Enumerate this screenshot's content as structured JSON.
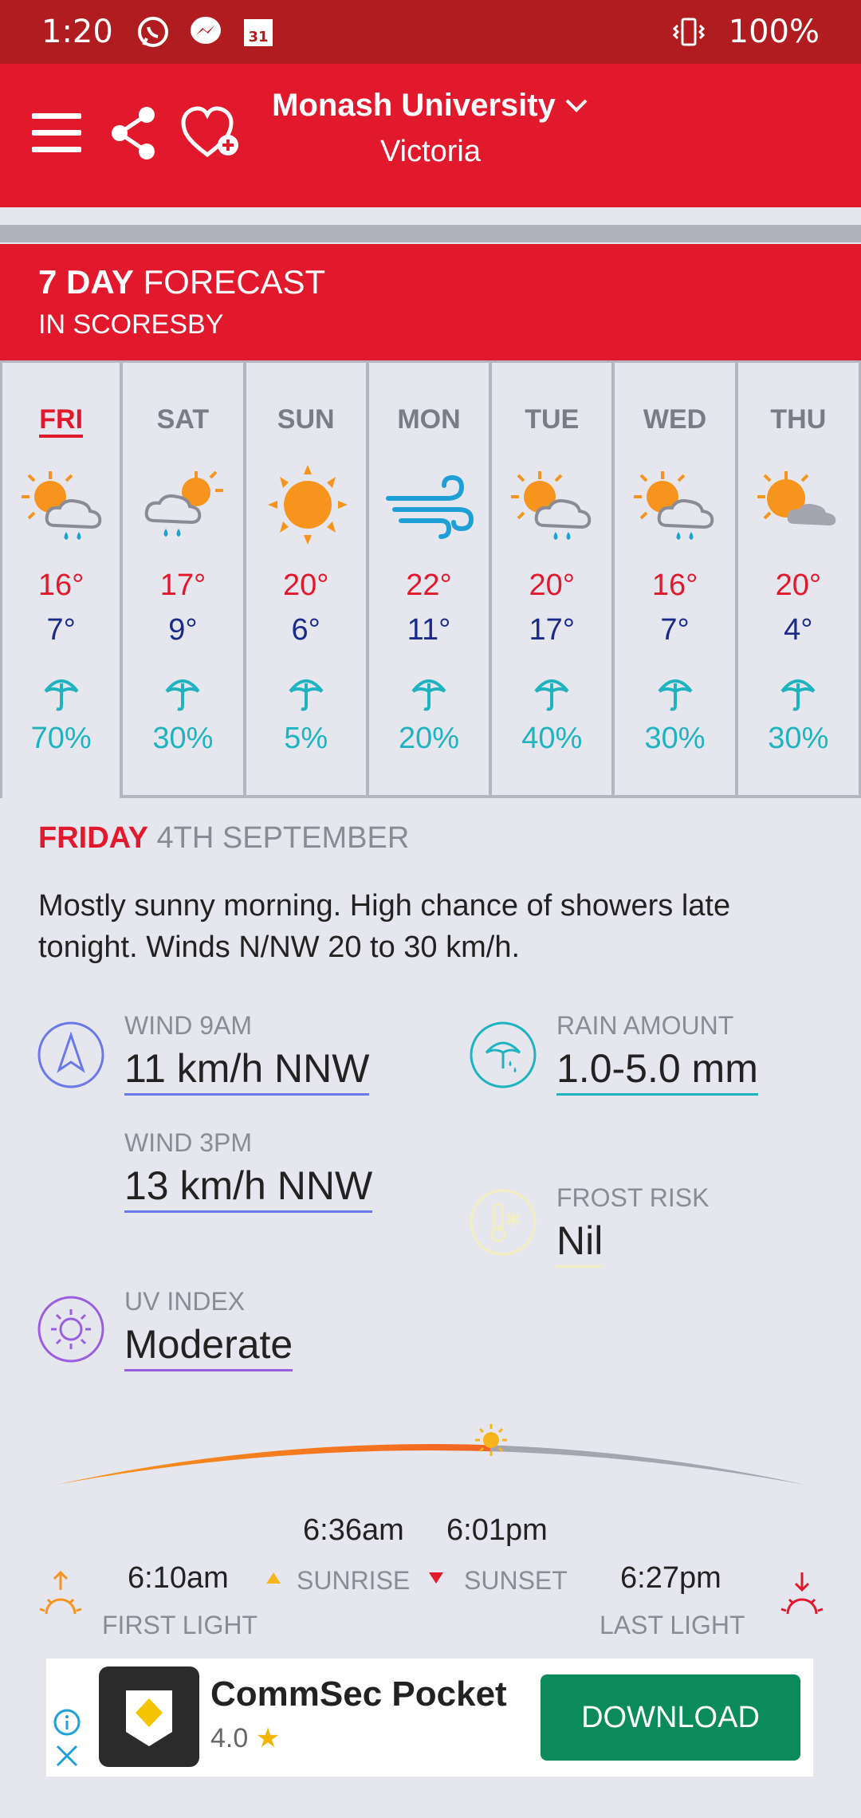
{
  "status_bar": {
    "time": "1:20",
    "battery": "100%"
  },
  "header": {
    "location_name": "Monash University",
    "location_region": "Victoria"
  },
  "forecast_header": {
    "title_bold": "7 DAY",
    "title_rest": "FORECAST",
    "subtitle": "IN SCORESBY"
  },
  "days": [
    {
      "name": "FRI",
      "icon": "sun-cloud-rain-icon",
      "high": "16°",
      "low": "7°",
      "rain_chance": "70%",
      "selected": true
    },
    {
      "name": "SAT",
      "icon": "cloud-sun-rain-icon",
      "high": "17°",
      "low": "9°",
      "rain_chance": "30%"
    },
    {
      "name": "SUN",
      "icon": "sun-icon",
      "high": "20°",
      "low": "6°",
      "rain_chance": "5%"
    },
    {
      "name": "MON",
      "icon": "wind-icon",
      "high": "22°",
      "low": "11°",
      "rain_chance": "20%"
    },
    {
      "name": "TUE",
      "icon": "sun-cloud-rain-icon",
      "high": "20°",
      "low": "17°",
      "rain_chance": "40%"
    },
    {
      "name": "WED",
      "icon": "sun-cloud-rain-icon",
      "high": "16°",
      "low": "7°",
      "rain_chance": "30%"
    },
    {
      "name": "THU",
      "icon": "sun-cloud-icon",
      "high": "20°",
      "low": "4°",
      "rain_chance": "30%"
    }
  ],
  "detail": {
    "day_name": "FRIDAY",
    "date": "4TH SEPTEMBER",
    "description": "Mostly sunny morning. High chance of showers late tonight. Winds N/NW 20 to 30 km/h.",
    "wind_9am": {
      "label": "WIND 9AM",
      "value": "11 km/h NNW"
    },
    "wind_3pm": {
      "label": "WIND 3PM",
      "value": "13 km/h NNW"
    },
    "rain_amount": {
      "label": "RAIN AMOUNT",
      "value": "1.0-5.0 mm"
    },
    "frost_risk": {
      "label": "FROST RISK",
      "value": "Nil"
    },
    "uv_index": {
      "label": "UV INDEX",
      "value": "Moderate"
    }
  },
  "sun": {
    "sunrise_time": "6:36am",
    "sunset_time": "6:01pm",
    "first_light_time": "6:10am",
    "last_light_time": "6:27pm",
    "sunrise_label": "SUNRISE",
    "sunset_label": "SUNSET",
    "first_light_label": "FIRST LIGHT",
    "last_light_label": "LAST LIGHT"
  },
  "ad": {
    "app_name": "CommSec Pocket",
    "rating": "4.0",
    "button_label": "DOWNLOAD"
  },
  "colors": {
    "brand_red": "#e2182d",
    "status_red": "#b01c1f",
    "rain_teal": "#1fb3c0",
    "high_red": "#e2182d",
    "low_navy": "#1a2a8a"
  }
}
